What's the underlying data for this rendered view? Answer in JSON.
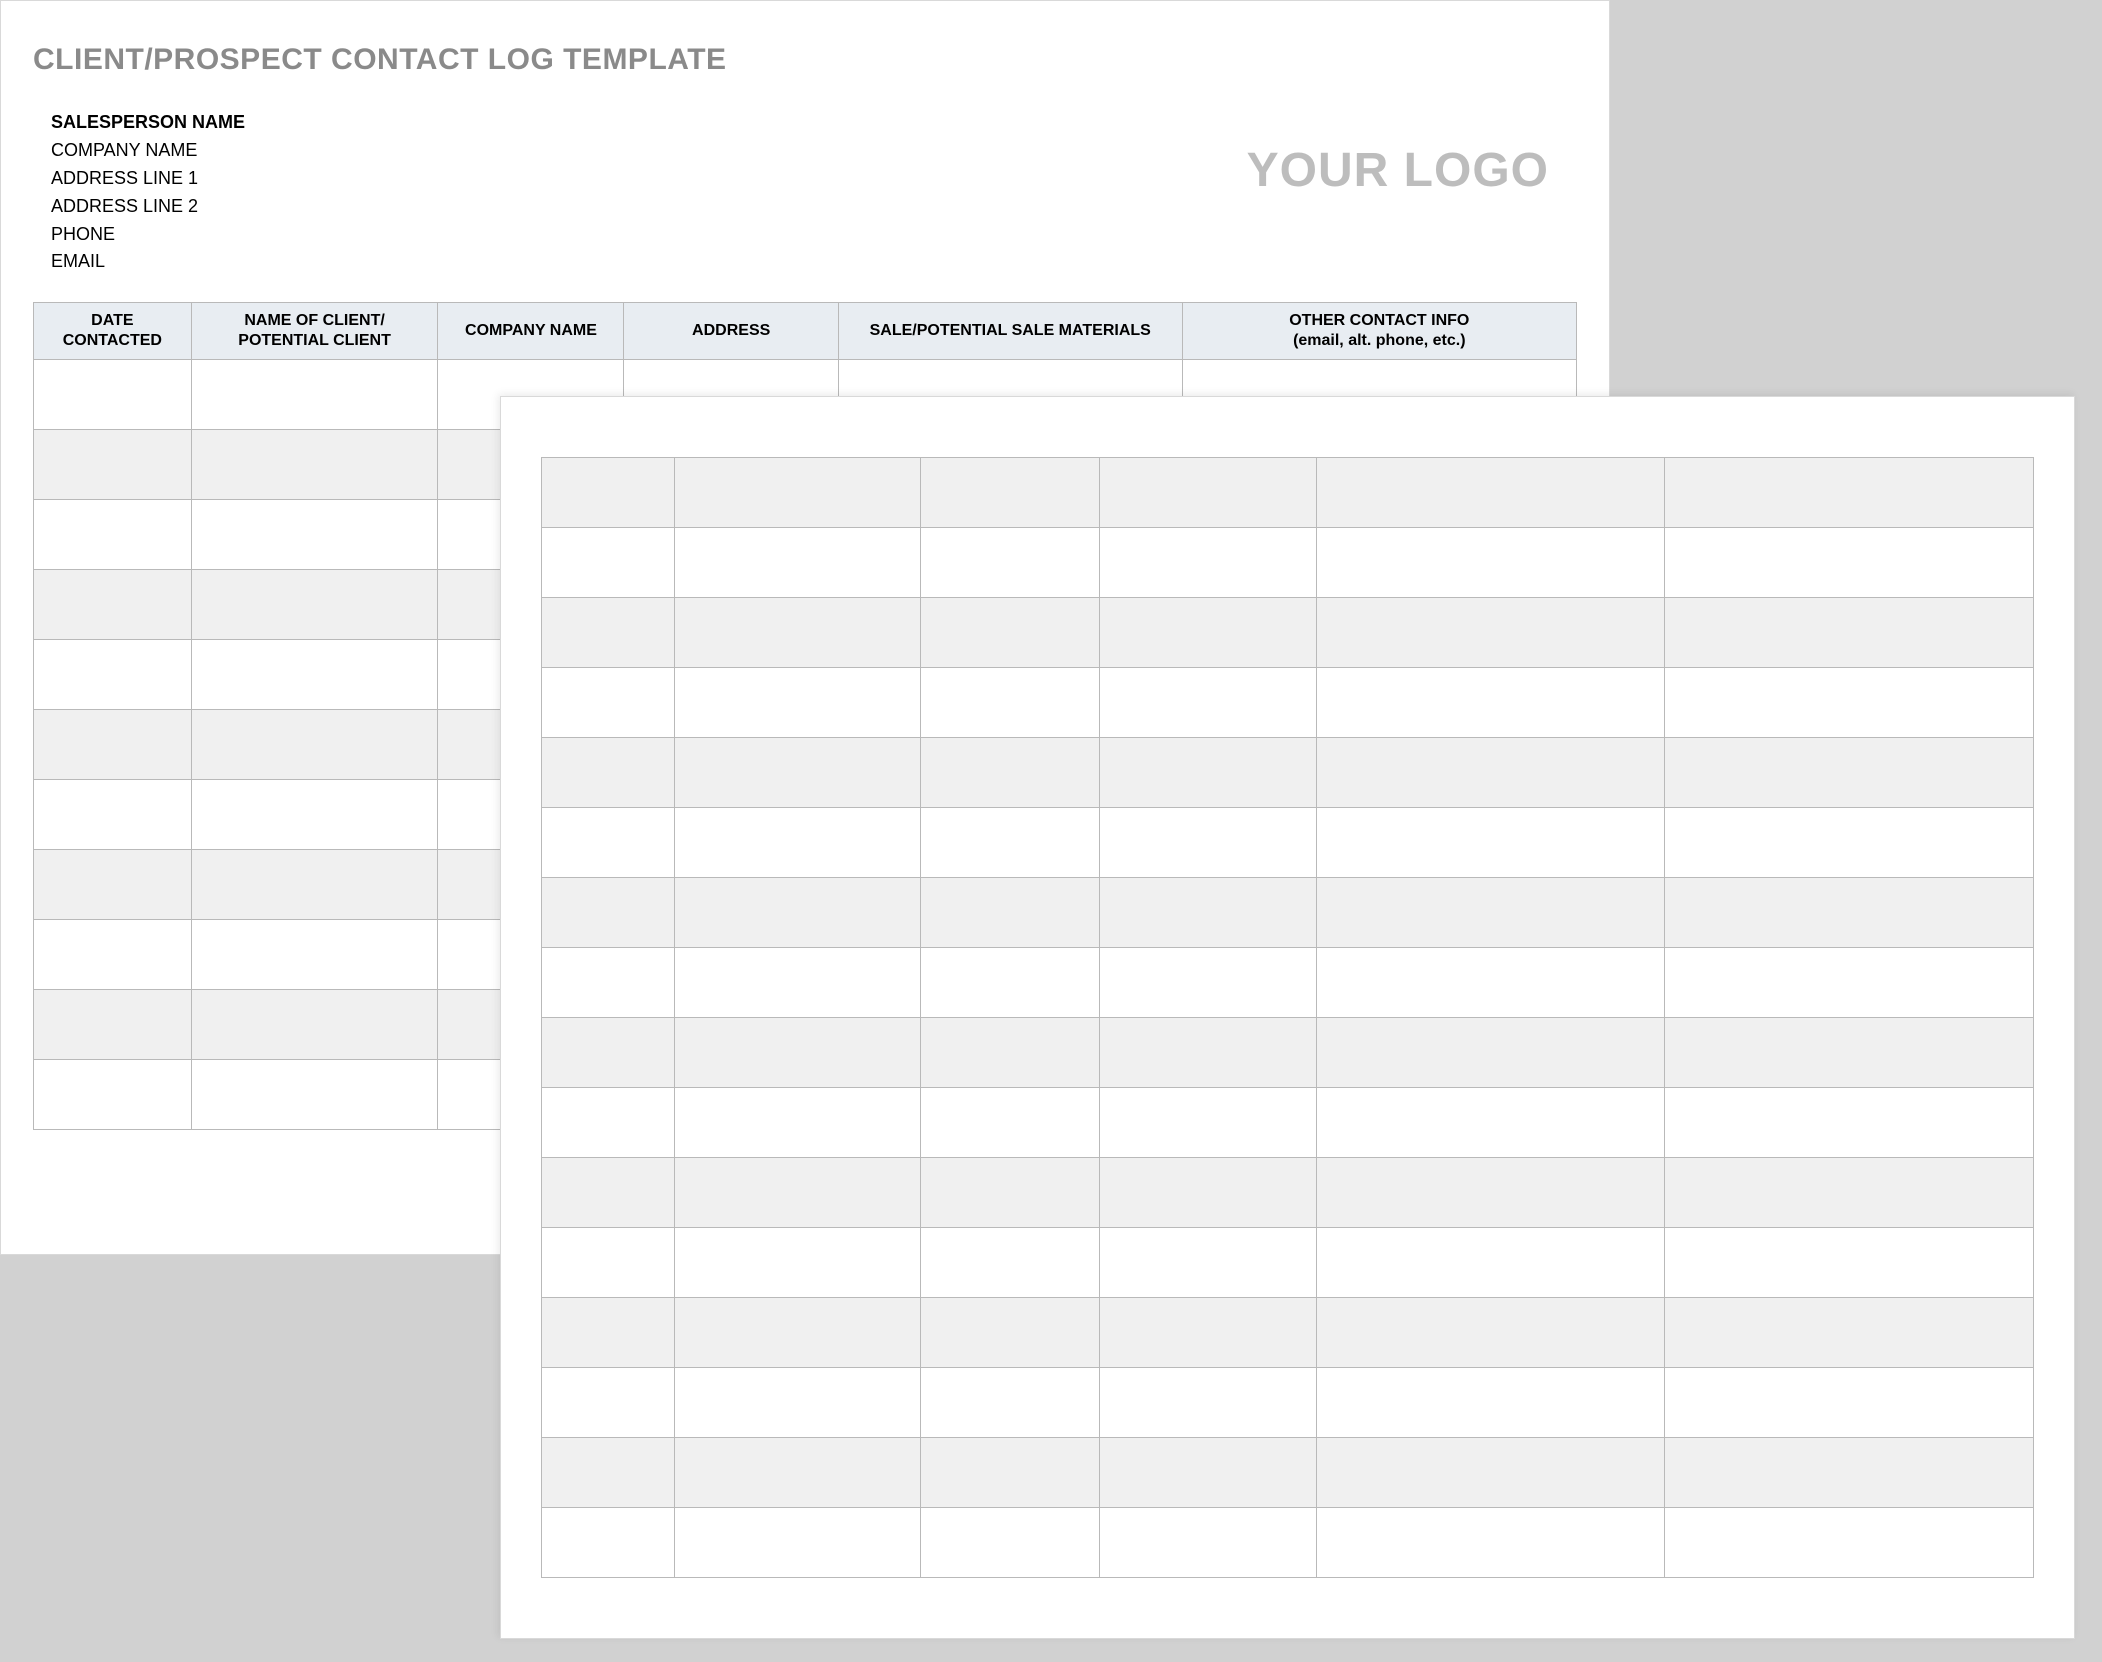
{
  "title": "CLIENT/PROSPECT CONTACT LOG TEMPLATE",
  "logo_text": "YOUR LOGO",
  "salesperson": {
    "name_label": "SALESPERSON NAME",
    "company": "COMPANY NAME",
    "address1": "ADDRESS LINE 1",
    "address2": "ADDRESS LINE 2",
    "phone": "PHONE",
    "email": "EMAIL"
  },
  "columns": {
    "date_contacted": "DATE CONTACTED",
    "client_name": "NAME OF CLIENT/ POTENTIAL CLIENT",
    "company_name": "COMPANY NAME",
    "address": "ADDRESS",
    "sale_materials": "SALE/POTENTIAL SALE MATERIALS",
    "other_contact_line1": "OTHER CONTACT INFO",
    "other_contact_line2": "(email, alt. phone, etc.)"
  }
}
